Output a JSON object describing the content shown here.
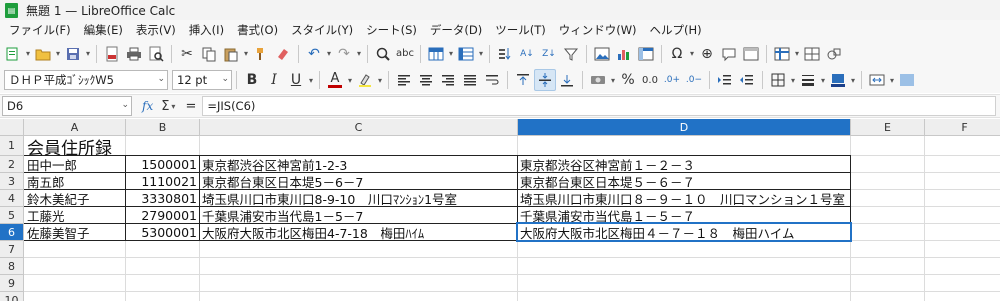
{
  "window": {
    "title": "無題 1 — LibreOffice Calc",
    "icon_text": "▤"
  },
  "menu": [
    "ファイル(F)",
    "編集(E)",
    "表示(V)",
    "挿入(I)",
    "書式(O)",
    "スタイル(Y)",
    "シート(S)",
    "データ(D)",
    "ツール(T)",
    "ウィンドウ(W)",
    "ヘルプ(H)"
  ],
  "toolbar1": [
    "new-icon",
    "open-icon",
    "save-icon",
    "export-pdf-icon",
    "print-icon",
    "print-preview-icon",
    "cut-icon",
    "copy-icon",
    "paste-icon",
    "clone-format-icon",
    "clear-icon",
    "undo-icon",
    "redo-icon",
    "find-icon",
    "spelling-icon",
    "row-icon",
    "column-icon",
    "sort-icon",
    "sort-asc-icon",
    "sort-desc-icon",
    "autofilter-icon",
    "image-icon",
    "chart-icon",
    "pivot-icon",
    "special-char-icon",
    "hyperlink-icon",
    "comment-icon",
    "headers-icon",
    "freeze-icon",
    "split-icon",
    "draw-icon"
  ],
  "toolbar2": {
    "font_name": "ＤＨＰ平成ｺﾞｼｯｸW5",
    "font_size": "12 pt",
    "bold": "B",
    "italic": "I",
    "underline": "U",
    "font_color_letter": "A",
    "percent": "%",
    "decimal_zero": "0.0"
  },
  "formula": {
    "cell_ref": "D6",
    "fx": "fx",
    "sigma": "Σ",
    "equals": "=",
    "content": "=JIS(C6)"
  },
  "columns": [
    "A",
    "B",
    "C",
    "D",
    "E",
    "F"
  ],
  "selected_column": "D",
  "rows": [
    "1",
    "2",
    "3",
    "4",
    "5",
    "6",
    "7",
    "8",
    "9",
    "10"
  ],
  "selected_row": "6",
  "sheet": {
    "title": "会員住所録",
    "records": [
      {
        "name": "田中一郎",
        "zip": "1500001",
        "addr": "東京都渋谷区神宮前1-2-3",
        "jis": "東京都渋谷区神宮前１－２－３"
      },
      {
        "name": "南五郎",
        "zip": "1110021",
        "addr": "東京都台東区日本堤5－6－7",
        "jis": "東京都台東区日本堤５－６－７"
      },
      {
        "name": "鈴木美紀子",
        "zip": "3330801",
        "addr": "埼玉県川口市東川口8-9-10　川口ﾏﾝｼｮﾝ1号室",
        "jis": "埼玉県川口市東川口８－９－１０　川口マンション１号室"
      },
      {
        "name": "工藤光",
        "zip": "2790001",
        "addr": "千葉県浦安市当代島1－5－7",
        "jis": "千葉県浦安市当代島１－５－７"
      },
      {
        "name": "佐藤美智子",
        "zip": "5300001",
        "addr": "大阪府大阪市北区梅田4-7-18　梅田ﾊｲﾑ",
        "jis": "大阪府大阪市北区梅田４－７－１８　梅田ハイム"
      }
    ]
  },
  "colors": {
    "selection": "#2172c6",
    "app_green": "#1e9d3c",
    "font_color_bar": "#c00000"
  }
}
